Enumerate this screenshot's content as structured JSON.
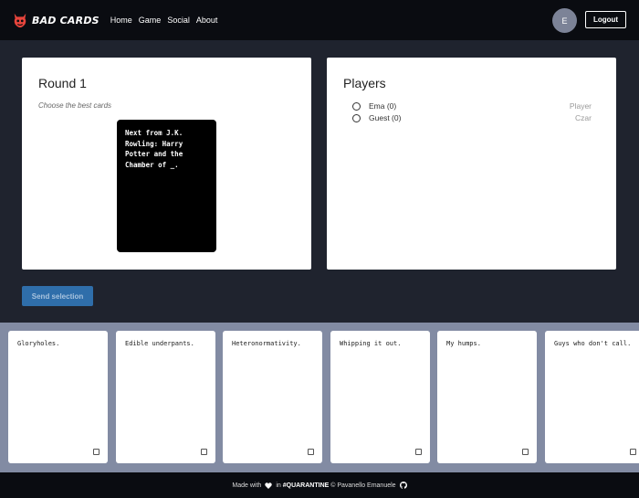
{
  "navbar": {
    "brand": "BAD CARDS",
    "links": [
      "Home",
      "Game",
      "Social",
      "About"
    ],
    "avatar_initial": "E",
    "logout_label": "Logout"
  },
  "round": {
    "title": "Round 1",
    "subtitle": "Choose the best cards",
    "black_card_text": "Next from J.K. Rowling: Harry Potter and the Chamber of _."
  },
  "players": {
    "title": "Players",
    "list": [
      {
        "name": "Ema (0)",
        "role": "Player"
      },
      {
        "name": "Guest (0)",
        "role": "Czar"
      }
    ]
  },
  "send_button_label": "Send selection",
  "hand": {
    "cards": [
      "Gloryholes.",
      "Edible underpants.",
      "Heteronormativity.",
      "Whipping it out.",
      "My humps.",
      "Guys who don't call."
    ]
  },
  "footer": {
    "made_with": "Made with",
    "in": "in",
    "hashtag": "#QUARANTINE",
    "copyright": "© Pavanello Emanuele"
  },
  "colors": {
    "page_bg": "#1f232e",
    "navbar_bg": "#0a0c11",
    "hand_bg": "#828ba3",
    "send_button": "#2f6eaa",
    "logo_red": "#e8453c"
  }
}
